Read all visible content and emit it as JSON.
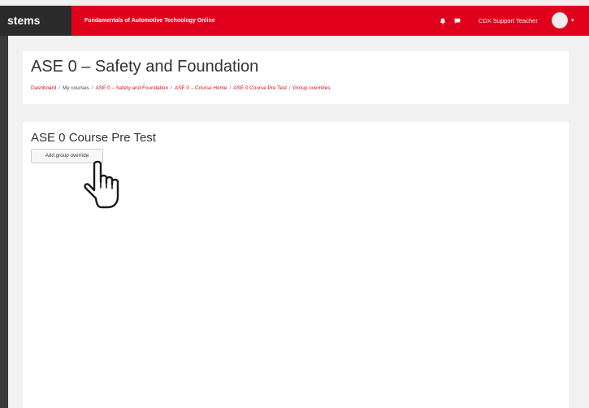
{
  "navbar": {
    "brand": "stems",
    "site_name": "Fundamentals of Automotive Technology Online",
    "notifications_icon": "bell-icon",
    "messages_icon": "speech-bubble-icon",
    "user_name": "CDX Support Teacher",
    "user_menu_caret": "▾",
    "accent_color": "#e0001b"
  },
  "header": {
    "title": "ASE 0 – Safety and Foundation",
    "breadcrumb": [
      {
        "label": "Dashboard",
        "link": true
      },
      {
        "label": "My courses",
        "link": false
      },
      {
        "label": "ASE 0 – Safety and Foundation",
        "link": true
      },
      {
        "label": "ASE 0 – Course Home",
        "link": true
      },
      {
        "label": "ASE 0 Course Pre Test",
        "link": true
      },
      {
        "label": "Group overrides",
        "link": true
      }
    ],
    "separator": "/"
  },
  "main": {
    "section_title": "ASE 0 Course Pre Test",
    "add_button_label": "Add group override"
  },
  "cursor_icon": "hand-pointer-icon"
}
